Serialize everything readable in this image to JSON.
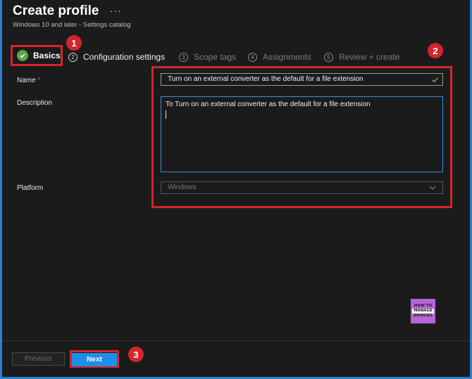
{
  "header": {
    "title": "Create profile",
    "more_label": "···",
    "subtitle": "Windows 10 and later - Settings catalog"
  },
  "steps": [
    {
      "number": "",
      "label": "Basics",
      "state": "completed"
    },
    {
      "number": "2",
      "label": "Configuration settings",
      "state": "active"
    },
    {
      "number": "3",
      "label": "Scope tags",
      "state": "disabled"
    },
    {
      "number": "4",
      "label": "Assignments",
      "state": "disabled"
    },
    {
      "number": "5",
      "label": "Review + create",
      "state": "disabled"
    }
  ],
  "annotations": [
    "1",
    "2",
    "3"
  ],
  "form": {
    "name_label": "Name",
    "required_mark": "*",
    "name_value": "Turn on an external converter as the default for a file extension",
    "description_label": "Description",
    "description_value": "To  Turn on an external converter as the default for a file extension",
    "platform_label": "Platform",
    "platform_value": "Windows"
  },
  "watermark": {
    "line1": "HOW TO",
    "line2": "MANAGE",
    "line3": "DEVICES"
  },
  "footer": {
    "previous_label": "Previous",
    "next_label": "Next"
  },
  "colors": {
    "accent": "#1f8ee8",
    "highlight": "#d2262c",
    "success": "#57a64a",
    "background": "#1b1b1b"
  }
}
